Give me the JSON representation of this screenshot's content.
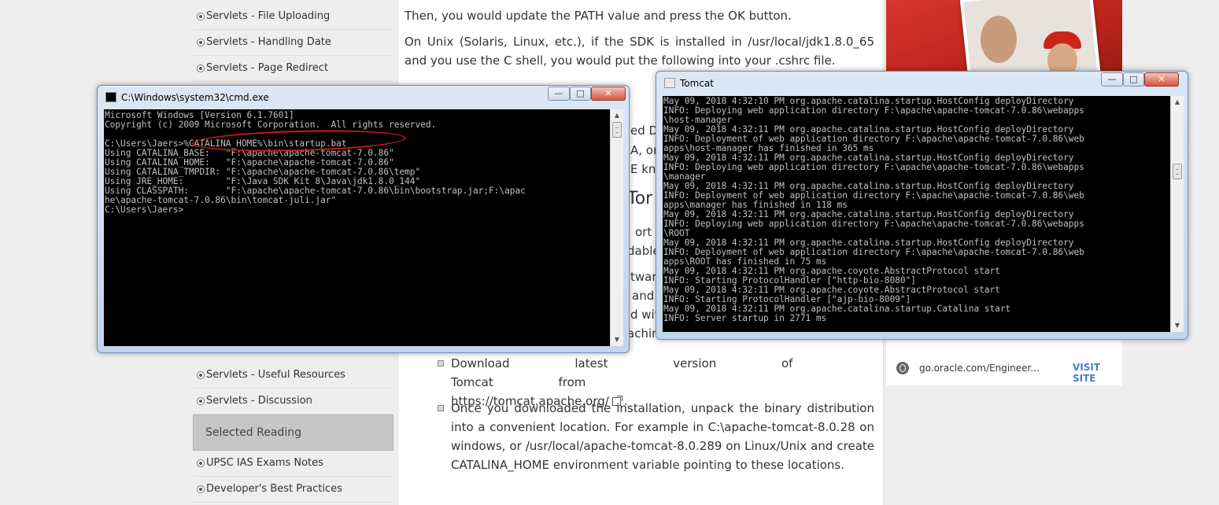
{
  "sidebar": {
    "items_top": [
      "Servlets - File Uploading",
      "Servlets - Handling Date",
      "Servlets - Page Redirect"
    ],
    "items_bottom": [
      "Servlets - Useful Resources",
      "Servlets - Discussion"
    ],
    "section_header": "Selected Reading",
    "reading_items": [
      "UPSC IAS Exams Notes",
      "Developer's Best Practices"
    ]
  },
  "article": {
    "para_path": "Then, you would update the PATH value and press the OK button.",
    "para_unix": "On Unix (Solaris, Linux, etc.), if the SDK is installed in /usr/local/jdk1.8.0_65 and you use the C shell, you would put the following into your .cshrc file.",
    "hidden_fragments": [
      "ed D",
      "A, or",
      "E kn",
      "Tor",
      "ort s",
      "dable",
      "tware",
      "and",
      "d wit",
      "achin"
    ],
    "bullet_download_text": "Download latest version of Tomcat from",
    "bullet_download_link": "https://tomcat.apache.org/",
    "bullet_download_end": ".",
    "bullet_unpack": "Once you downloaded the installation, unpack the binary distribution into a convenient location. For example in C:\\apache-tomcat-8.0.28 on windows, or /usr/local/apache-tomcat-8.0.289 on Linux/Unix and create CATALINA_HOME environment variable pointing to these locations."
  },
  "ad": {
    "url": "go.oracle.com/Engineer...",
    "cta": "VISIT SITE"
  },
  "cmd_window": {
    "title": "C:\\Windows\\system32\\cmd.exe",
    "lines": [
      "Microsoft Windows [Version 6.1.7601]",
      "Copyright (c) 2009 Microsoft Corporation.  All rights reserved.",
      "",
      "C:\\Users\\Jaers>%CATALINA_HOME%\\bin\\startup.bat",
      "Using CATALINA_BASE:   \"F:\\apache\\apache-tomcat-7.0.86\"",
      "Using CATALINA_HOME:   \"F:\\apache\\apache-tomcat-7.0.86\"",
      "Using CATALINA_TMPDIR: \"F:\\apache\\apache-tomcat-7.0.86\\temp\"",
      "Using JRE_HOME:        \"F:\\Java SDK Kit 8\\Java\\jdk1.8.0_144\"",
      "Using CLASSPATH:       \"F:\\apache\\apache-tomcat-7.0.86\\bin\\bootstrap.jar;F:\\apac",
      "he\\apache-tomcat-7.0.86\\bin\\tomcat-juli.jar\"",
      "C:\\Users\\Jaers>"
    ]
  },
  "tomcat_window": {
    "title": "Tomcat",
    "lines": [
      "May 09, 2018 4:32:10 PM org.apache.catalina.startup.HostConfig deployDirectory",
      "INFO: Deploying web application directory F:\\apache\\apache-tomcat-7.0.86\\webapps",
      "\\host-manager",
      "May 09, 2018 4:32:11 PM org.apache.catalina.startup.HostConfig deployDirectory",
      "INFO: Deployment of web application directory F:\\apache\\apache-tomcat-7.0.86\\web",
      "apps\\host-manager has finished in 365 ms",
      "May 09, 2018 4:32:11 PM org.apache.catalina.startup.HostConfig deployDirectory",
      "INFO: Deploying web application directory F:\\apache\\apache-tomcat-7.0.86\\webapps",
      "\\manager",
      "May 09, 2018 4:32:11 PM org.apache.catalina.startup.HostConfig deployDirectory",
      "INFO: Deployment of web application directory F:\\apache\\apache-tomcat-7.0.86\\web",
      "apps\\manager has finished in 118 ms",
      "May 09, 2018 4:32:11 PM org.apache.catalina.startup.HostConfig deployDirectory",
      "INFO: Deploying web application directory F:\\apache\\apache-tomcat-7.0.86\\webapps",
      "\\ROOT",
      "May 09, 2018 4:32:11 PM org.apache.catalina.startup.HostConfig deployDirectory",
      "INFO: Deployment of web application directory F:\\apache\\apache-tomcat-7.0.86\\web",
      "apps\\ROOT has finished in 75 ms",
      "May 09, 2018 4:32:11 PM org.apache.coyote.AbstractProtocol start",
      "INFO: Starting ProtocolHandler [\"http-bio-8080\"]",
      "May 09, 2018 4:32:11 PM org.apache.coyote.AbstractProtocol start",
      "INFO: Starting ProtocolHandler [\"ajp-bio-8009\"]",
      "May 09, 2018 4:32:11 PM org.apache.catalina.startup.Catalina start",
      "INFO: Server startup in 2771 ms"
    ]
  },
  "window_buttons": {
    "minimize": "—",
    "maximize": "□",
    "close": "✕"
  },
  "scroll_arrows": {
    "up": "▲",
    "down": "▼"
  },
  "colors": {
    "accent_link": "#4a7fc1",
    "annotation": "#d01818",
    "console_bg": "#000000",
    "console_text": "#c0c0c0"
  }
}
